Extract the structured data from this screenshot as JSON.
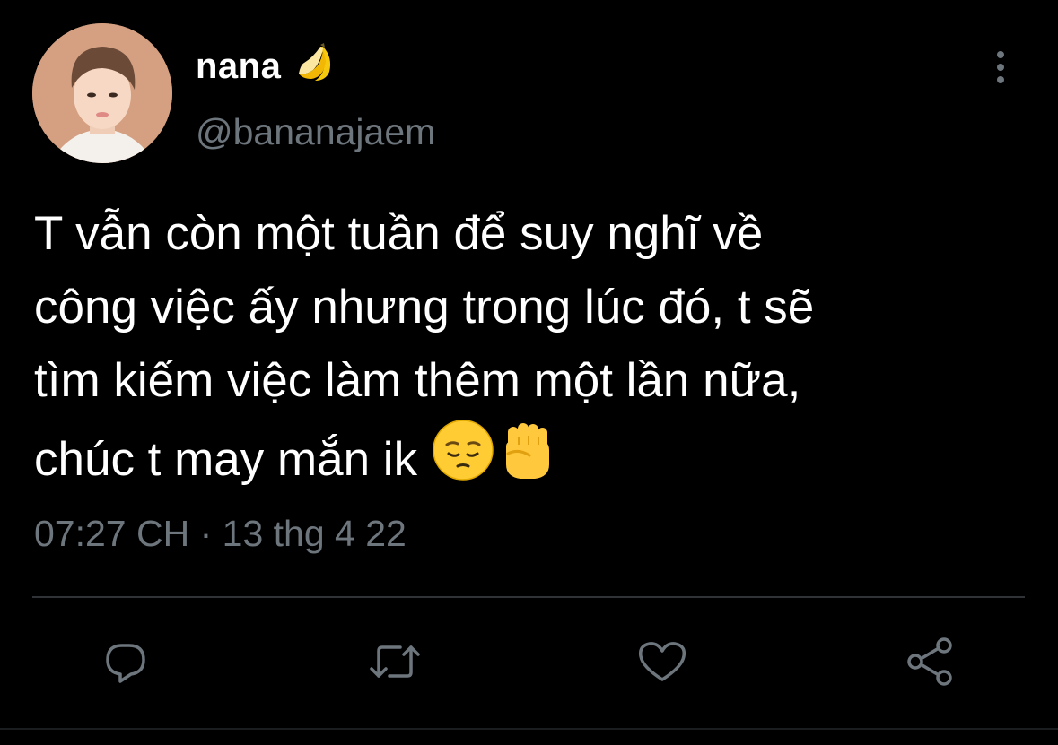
{
  "user": {
    "display_name": "nana",
    "name_emoji": "banana",
    "handle": "@bananajaem"
  },
  "tweet": {
    "text": "T vẫn còn một tuần để suy nghĩ về\ncông việc ấy nhưng trong lúc đó, t sẽ\ntìm kiếm việc làm thêm một lần nữa,\nchúc t may mắn ik",
    "emojis": [
      "pensive-face",
      "raised-fist"
    ],
    "timestamp": "07:27 CH · 13 thg 4 22"
  },
  "actions": [
    "reply",
    "retweet",
    "like",
    "share"
  ],
  "colors": {
    "background": "#000000",
    "text": "#ffffff",
    "secondary": "#6e767d",
    "divider": "#2f3336"
  }
}
